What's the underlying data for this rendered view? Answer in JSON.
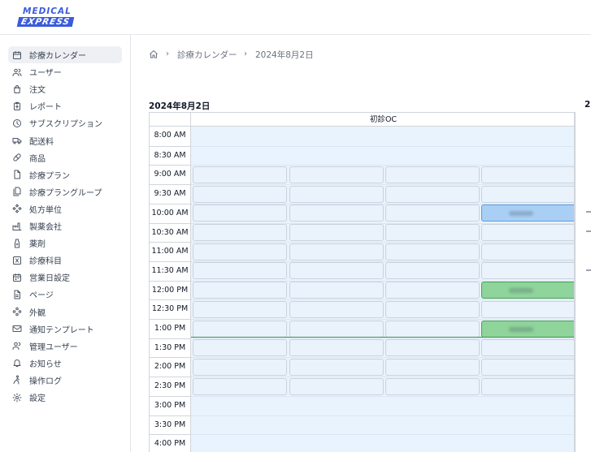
{
  "logo": {
    "line1": "MEDICAL",
    "line2": "EXPRESS"
  },
  "sidebar": {
    "items": [
      {
        "label": "診療カレンダー",
        "icon": "calendar-icon",
        "active": true
      },
      {
        "label": "ユーザー",
        "icon": "users-icon"
      },
      {
        "label": "注文",
        "icon": "shopping-bag-icon"
      },
      {
        "label": "レポート",
        "icon": "clipboard-icon"
      },
      {
        "label": "サブスクリプション",
        "icon": "clock-icon"
      },
      {
        "label": "配送料",
        "icon": "truck-icon"
      },
      {
        "label": "商品",
        "icon": "pill-icon"
      },
      {
        "label": "診療プラン",
        "icon": "document-icon"
      },
      {
        "label": "診療プラングループ",
        "icon": "documents-icon"
      },
      {
        "label": "処方単位",
        "icon": "puzzle-icon"
      },
      {
        "label": "製薬会社",
        "icon": "factory-icon"
      },
      {
        "label": "薬剤",
        "icon": "bottle-icon"
      },
      {
        "label": "診療科目",
        "icon": "medical-box-icon"
      },
      {
        "label": "営業日設定",
        "icon": "calendar-days-icon"
      },
      {
        "label": "ページ",
        "icon": "page-icon"
      },
      {
        "label": "外観",
        "icon": "palette-icon"
      },
      {
        "label": "通知テンプレート",
        "icon": "mail-icon"
      },
      {
        "label": "管理ユーザー",
        "icon": "admin-users-icon"
      },
      {
        "label": "お知らせ",
        "icon": "bell-icon"
      },
      {
        "label": "操作ログ",
        "icon": "activity-icon"
      },
      {
        "label": "設定",
        "icon": "gear-icon"
      }
    ]
  },
  "breadcrumb": {
    "home_icon": "home-icon",
    "page": "診療カレンダー",
    "current": "2024年8月2日",
    "separator": "›"
  },
  "calendar": {
    "date_title": "2024年8月2日",
    "next_date_title_fragment": "2",
    "column_header": "初診OC",
    "times": [
      "8:00 AM",
      "8:30 AM",
      "9:00 AM",
      "9:30 AM",
      "10:00 AM",
      "10:30 AM",
      "11:00 AM",
      "11:30 AM",
      "12:00 PM",
      "12:30 PM",
      "1:00 PM",
      "1:30 PM",
      "2:00 PM",
      "2:30 PM",
      "3:00 PM",
      "3:30 PM",
      "4:00 PM"
    ],
    "slot_rows": [
      2,
      3,
      4,
      5,
      6,
      7,
      8,
      9,
      10,
      11,
      12,
      13
    ],
    "booked": [
      {
        "row": 4,
        "col": 3,
        "status": "blue"
      },
      {
        "row": 8,
        "col": 3,
        "status": "green"
      },
      {
        "row": 10,
        "col": 3,
        "status": "green"
      }
    ],
    "colors": {
      "free": "#eaf2fb",
      "booked_blue": "#a9d0f4",
      "booked_green": "#8fd49b",
      "background": "#e9f3fd"
    }
  }
}
